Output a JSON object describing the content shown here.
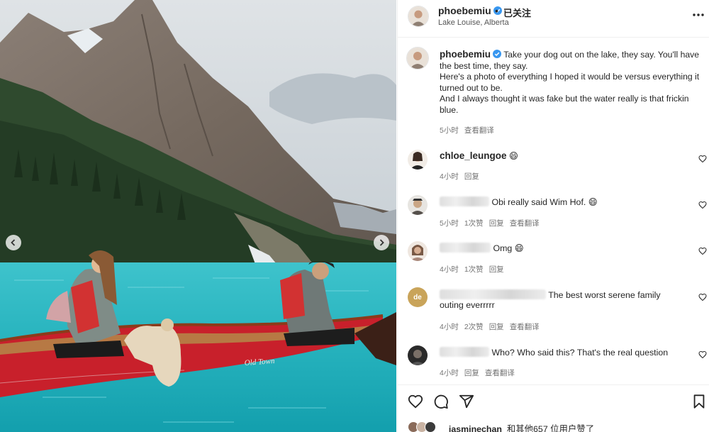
{
  "post": {
    "username": "phoebemiu",
    "follow_status": "已关注",
    "dot": "•",
    "location": "Lake Louise, Alberta"
  },
  "caption": {
    "username": "phoebemiu",
    "lines": [
      "Take your dog out on the lake, they say. You'll have the best time, they say.",
      "Here's a photo of everything I hoped it would be versus everything it turned out to be.",
      "And I always thought it was fake but the water really is that frickin blue."
    ],
    "time": "5小时",
    "translate": "查看翻译"
  },
  "comments": [
    {
      "username": "chloe_leungoe",
      "text": "😄",
      "time": "4小时",
      "likes": "",
      "reply": "回复",
      "translate": ""
    },
    {
      "username": "",
      "text": "Obi really said Wim Hof. 😄",
      "time": "5小时",
      "likes": "1次赞",
      "reply": "回复",
      "translate": "查看翻译"
    },
    {
      "username": "",
      "text": "Omg 😄",
      "time": "4小时",
      "likes": "1次赞",
      "reply": "回复",
      "translate": ""
    },
    {
      "username": "",
      "text": "The best worst serene family",
      "text2": "outing everrrrr",
      "time": "4小时",
      "likes": "2次赞",
      "reply": "回复",
      "translate": "查看翻译"
    },
    {
      "username": "",
      "text": "Who? Who said this? That's the real question",
      "time": "4小时",
      "likes": "",
      "reply": "回复",
      "translate": "查看翻译"
    }
  ],
  "avatar_badges": {
    "comment4": "de"
  },
  "likes": {
    "first_user": "_jasminechan_",
    "rest": "和其他657 位用户赞了"
  },
  "icons": {
    "verified": "verified-badge-icon",
    "more": "more-options-icon",
    "heart": "heart-icon",
    "comment": "comment-icon",
    "share": "share-icon",
    "save": "bookmark-icon",
    "prev": "chevron-left-icon",
    "next": "chevron-right-icon"
  },
  "colors": {
    "verified": "#3897f0",
    "lake": "#2fb8c4",
    "canoe": "#c8202b"
  }
}
